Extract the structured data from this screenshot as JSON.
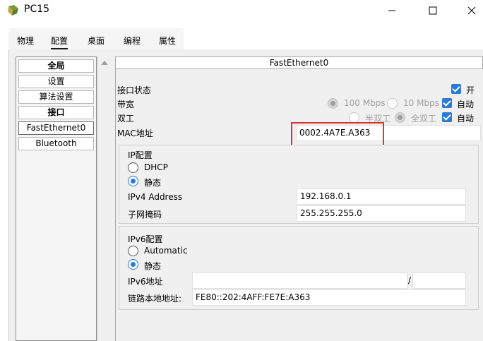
{
  "window": {
    "title": "PC15",
    "minimize_glyph": "—",
    "maximize_glyph": "☐",
    "close_glyph": "✕"
  },
  "tabs": [
    {
      "label": "物理"
    },
    {
      "label": "配置"
    },
    {
      "label": "桌面"
    },
    {
      "label": "编程"
    },
    {
      "label": "属性"
    }
  ],
  "left_list": [
    {
      "label": "全局"
    },
    {
      "label": "设置"
    },
    {
      "label": "算法设置"
    },
    {
      "label": "接口"
    },
    {
      "label": "FastEthernet0"
    },
    {
      "label": "Bluetooth"
    }
  ],
  "panel": {
    "header": "FastEthernet0",
    "port_status_label": "接口状态",
    "port_on_label": "开",
    "bandwidth_label": "带宽",
    "bw_100": "100 Mbps",
    "bw_10": "10 Mbps",
    "bw_auto": "自动",
    "duplex_label": "双工",
    "half_duplex": "半双工",
    "full_duplex": "全双工",
    "duplex_auto": "自动",
    "mac_label": "MAC地址",
    "mac_value": "0002.4A7E.A363",
    "ip_config_title": "IP配置",
    "dhcp_label": "DHCP",
    "static_label": "静态",
    "ipv4_label": "IPv4 Address",
    "ipv4_value": "192.168.0.1",
    "subnet_label": "子网掩码",
    "subnet_value": "255.255.255.0",
    "ipv6_config_title": "IPv6配置",
    "automatic_label": "Automatic",
    "static6_label": "静态",
    "ipv6_addr_label": "IPv6地址",
    "ipv6_addr_value": "",
    "ipv6_slash": "/",
    "ipv6_prefix_value": "",
    "linklocal_label": "链路本地地址:",
    "linklocal_value": "FE80::202:4AFF:FE7E:A363"
  },
  "colors": {
    "accent": "#2b7bd6",
    "highlight": "#e03434"
  }
}
